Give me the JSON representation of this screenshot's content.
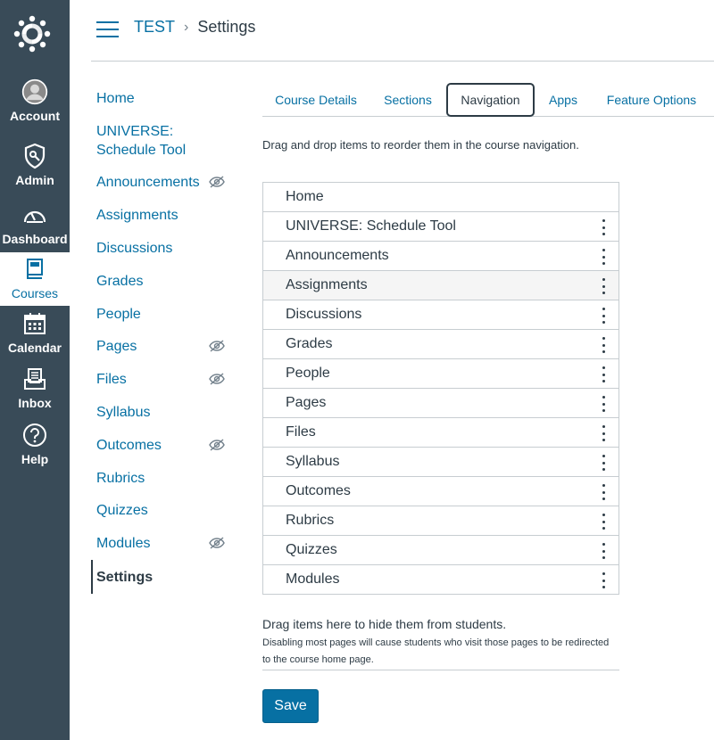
{
  "global_nav": {
    "items": [
      {
        "label": "Account",
        "icon": "account-avatar-icon"
      },
      {
        "label": "Admin",
        "icon": "admin-shield-icon"
      },
      {
        "label": "Dashboard",
        "icon": "dashboard-gauge-icon"
      },
      {
        "label": "Courses",
        "icon": "courses-book-icon",
        "active": true
      },
      {
        "label": "Calendar",
        "icon": "calendar-icon"
      },
      {
        "label": "Inbox",
        "icon": "inbox-icon"
      },
      {
        "label": "Help",
        "icon": "help-question-icon"
      }
    ]
  },
  "header": {
    "breadcrumb_course": "TEST",
    "breadcrumb_separator": "›",
    "breadcrumb_current": "Settings"
  },
  "course_nav": {
    "items": [
      {
        "label": "Home",
        "hidden": false
      },
      {
        "label": "UNIVERSE: Schedule Tool",
        "hidden": false
      },
      {
        "label": "Announcements",
        "hidden": true
      },
      {
        "label": "Assignments",
        "hidden": false
      },
      {
        "label": "Discussions",
        "hidden": false
      },
      {
        "label": "Grades",
        "hidden": false
      },
      {
        "label": "People",
        "hidden": false
      },
      {
        "label": "Pages",
        "hidden": true
      },
      {
        "label": "Files",
        "hidden": true
      },
      {
        "label": "Syllabus",
        "hidden": false
      },
      {
        "label": "Outcomes",
        "hidden": true
      },
      {
        "label": "Rubrics",
        "hidden": false
      },
      {
        "label": "Quizzes",
        "hidden": false
      },
      {
        "label": "Modules",
        "hidden": true
      },
      {
        "label": "Settings",
        "active": true
      }
    ]
  },
  "tabs": {
    "items": [
      {
        "label": "Course Details"
      },
      {
        "label": "Sections"
      },
      {
        "label": "Navigation",
        "active": true
      },
      {
        "label": "Apps"
      },
      {
        "label": "Feature Options"
      }
    ]
  },
  "navigation": {
    "instructions": "Drag and drop items to reorder them in the course navigation.",
    "items": [
      {
        "label": "Home",
        "has_menu": false
      },
      {
        "label": "UNIVERSE: Schedule Tool",
        "has_menu": true
      },
      {
        "label": "Announcements",
        "has_menu": true
      },
      {
        "label": "Assignments",
        "has_menu": true,
        "hover": true
      },
      {
        "label": "Discussions",
        "has_menu": true
      },
      {
        "label": "Grades",
        "has_menu": true
      },
      {
        "label": "People",
        "has_menu": true
      },
      {
        "label": "Pages",
        "has_menu": true
      },
      {
        "label": "Files",
        "has_menu": true
      },
      {
        "label": "Syllabus",
        "has_menu": true
      },
      {
        "label": "Outcomes",
        "has_menu": true
      },
      {
        "label": "Rubrics",
        "has_menu": true
      },
      {
        "label": "Quizzes",
        "has_menu": true
      },
      {
        "label": "Modules",
        "has_menu": true
      }
    ],
    "hidden_title": "Drag items here to hide them from students.",
    "hidden_note": "Disabling most pages will cause students who visit those pages to be redirected to the course home page.",
    "save_label": "Save"
  },
  "colors": {
    "global_nav_bg": "#394b58",
    "link": "#0770a3",
    "text": "#2d3b45",
    "border": "#c7cdd1",
    "hover_row": "#f5f5f5"
  }
}
